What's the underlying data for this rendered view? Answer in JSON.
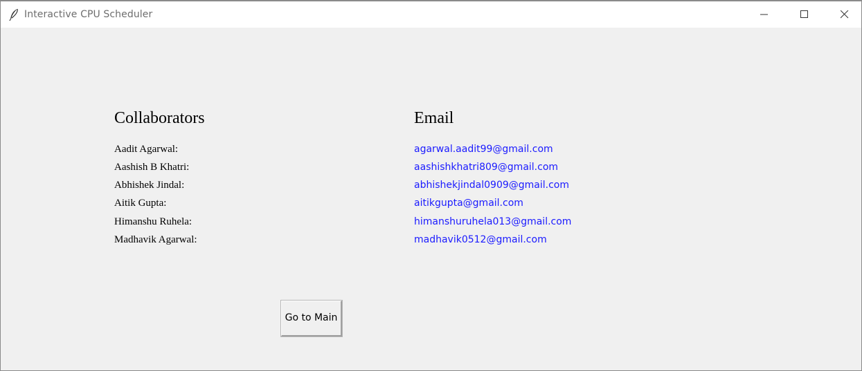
{
  "window": {
    "title": "Interactive CPU Scheduler",
    "app_icon": "feather-icon",
    "controls": {
      "minimize_icon": "minimize-icon",
      "maximize_icon": "maximize-icon",
      "close_icon": "close-icon"
    }
  },
  "table": {
    "headers": {
      "collaborators": "Collaborators",
      "email": "Email"
    },
    "rows": [
      {
        "name": "Aadit Agarwal:",
        "email": "agarwal.aadit99@gmail.com"
      },
      {
        "name": "Aashish B Khatri:",
        "email": "aashishkhatri809@gmail.com"
      },
      {
        "name": "Abhishek Jindal:",
        "email": "abhishekjindal0909@gmail.com"
      },
      {
        "name": "Aitik Gupta:",
        "email": "aitikgupta@gmail.com"
      },
      {
        "name": "Himanshu Ruhela:",
        "email": "himanshuruhela013@gmail.com"
      },
      {
        "name": "Madhavik Agarwal:",
        "email": "madhavik0512@gmail.com"
      }
    ]
  },
  "actions": {
    "go_to_main_label": "Go to Main"
  },
  "colors": {
    "background": "#f0f0f0",
    "titlebar": "#ffffff",
    "email_link": "#1a1aff",
    "text": "#000000"
  }
}
